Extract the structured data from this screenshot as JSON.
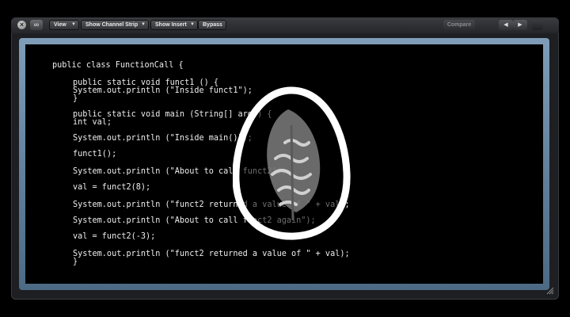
{
  "toolbar": {
    "close_glyph": "×",
    "link_glyph": "∞",
    "menus": [
      {
        "label": "View"
      },
      {
        "label": "Show Channel Strip"
      },
      {
        "label": "Show Insert"
      }
    ],
    "bypass_label": "Bypass",
    "compare_label": "Compare",
    "prev_glyph": "◀",
    "next_glyph": "▶",
    "dropdown_glyph": "▼"
  },
  "code_lines": [
    "public class FunctionCall {",
    "public static void funct1 () {",
    "System.out.println (\"Inside funct1\");",
    "}",
    "public static void main (String[] args) {",
    "int val;",
    "System.out.println (\"Inside main()\");",
    "funct1();",
    "System.out.println (\"About to call funct2\");",
    "val = funct2(8);",
    "System.out.println (\"funct2 returned a value of \" + val);",
    "System.out.println (\"About to call funct2 again\");",
    "val = funct2(-3);",
    "System.out.println (\"funct2 returned a value of \" + val);",
    "}"
  ],
  "colors": {
    "window_bg": "#1d1f22",
    "frame_blue": "#6f8daa",
    "code_text": "#eeeeee",
    "brain_outline": "#ffffff",
    "brain_fill": "#9a9a9a"
  },
  "icons": {
    "overlay": "brain-outline-icon",
    "resize": "resize-grip-icon"
  }
}
